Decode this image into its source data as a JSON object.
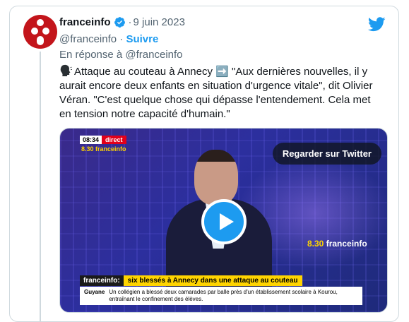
{
  "account": {
    "name": "franceinfo",
    "date": "9 juin 2023",
    "separator": "·",
    "handle": "@franceinfo",
    "follow_sep": " · ",
    "follow_label": "Suivre",
    "reply_to": "En réponse à @franceinfo"
  },
  "tweet": {
    "text": "Attaque au couteau à Annecy ➡️ \"Aux dernières nouvelles, il y aurait encore deux enfants en situation d'urgence vitale\", dit Olivier Véran. \"C'est quelque chose qui dépasse l'entendement. Cela met en tension notre capacité d'humain.\"",
    "emoji_icon": "speaking-head-icon"
  },
  "media": {
    "watch_label": "Regarder sur Twitter",
    "clock": "08:34",
    "live": "direct",
    "show_top": "8.30 franceinfo",
    "show_right_time": "8.30",
    "show_right_brand": " franceinfo",
    "lower_brand": "franceinfo:",
    "lower_headline": "six blessés à Annecy dans une attaque au couteau",
    "ticker_place": "Guyane",
    "ticker_text": "Un collégien a blessé deux camarades par balle près d'un établissement scolaire à Kourou, entraînant le confinement des élèves."
  },
  "colors": {
    "accent": "#1d9bf0",
    "brand_red": "#c3151b",
    "secondary_text": "#536471"
  }
}
